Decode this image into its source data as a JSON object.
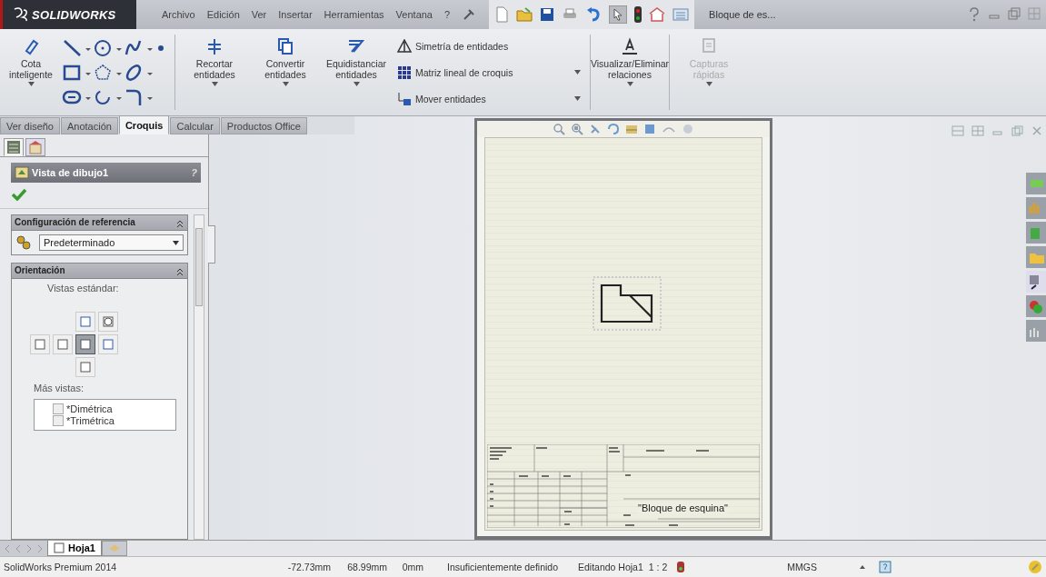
{
  "app": {
    "logo_text": "SOLIDWORKS"
  },
  "menu": [
    "Archivo",
    "Edición",
    "Ver",
    "Insertar",
    "Herramientas",
    "Ventana",
    "?"
  ],
  "document_title": "Bloque de es...",
  "ribbon": {
    "tools": [
      {
        "kind": "big",
        "label": "Cota inteligente",
        "disabled": false
      },
      {
        "kind": "sketch_grid"
      },
      {
        "kind": "big",
        "label": "Recortar entidades",
        "disabled": false
      },
      {
        "kind": "big",
        "label": "Convertir entidades",
        "disabled": false
      },
      {
        "kind": "big",
        "label": "Equidistanciar entidades",
        "disabled": false
      },
      {
        "kind": "stack",
        "items": [
          "Simetría de entidades",
          "Matriz lineal de croquis",
          "Mover entidades"
        ]
      },
      {
        "kind": "big",
        "label": "Visualizar/Eliminar relaciones",
        "disabled": false
      },
      {
        "kind": "big",
        "label": "Capturas rápidas",
        "disabled": true
      }
    ]
  },
  "command_tabs": [
    {
      "label": "Ver diseño",
      "selected": false
    },
    {
      "label": "Anotación",
      "selected": false
    },
    {
      "label": "Croquis",
      "selected": true
    },
    {
      "label": "Calcular",
      "selected": false
    },
    {
      "label": "Productos Office",
      "selected": false
    }
  ],
  "property_manager": {
    "panel_tabs": [
      {
        "selected": true
      },
      {
        "selected": false
      }
    ],
    "title": "Vista de dibujo1",
    "help": "?",
    "reference_group": {
      "title": "Configuración de referencia",
      "expanded": true,
      "value": "Predeterminado"
    },
    "orientation_group": {
      "title": "Orientación",
      "expanded": true,
      "standard_label": "Vistas estándar:",
      "views": [
        {
          "selected": false
        },
        {
          "selected": false
        },
        {
          "selected": false
        },
        {
          "selected": false
        },
        {
          "selected": true
        },
        {
          "selected": false
        },
        {
          "selected": false
        }
      ],
      "more_label": "Más vistas:",
      "more_views": [
        {
          "label": "*Dimétrica",
          "checked": false
        },
        {
          "label": "*Trimétrica",
          "checked": false
        }
      ]
    }
  },
  "sheet": {
    "title_block_text": "\"Bloque de esquina\""
  },
  "sheet_tabs": [
    {
      "label": "Hoja1",
      "selected": true
    }
  ],
  "status_bar": {
    "product": "SolidWorks Premium 2014",
    "x": "-72.73mm",
    "y": "68.99mm",
    "z": "0mm",
    "state": "Insuficientemente definido",
    "mode": "Editando Hoja1",
    "scale": "1 : 2",
    "units": "MMGS"
  }
}
